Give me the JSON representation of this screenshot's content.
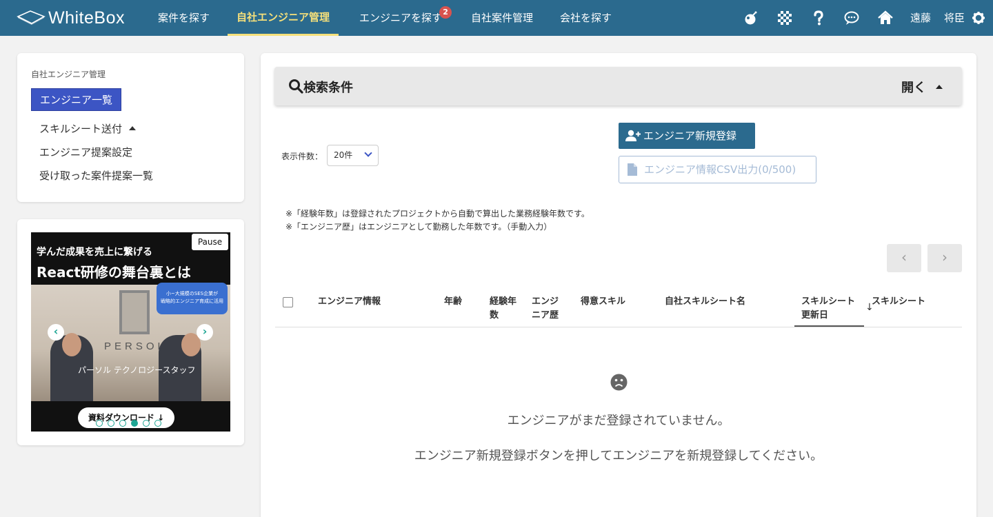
{
  "app": {
    "logo_text": "WhiteBox"
  },
  "nav": {
    "items": [
      {
        "label": "案件を探す"
      },
      {
        "label": "自社エンジニア管理"
      },
      {
        "label": "エンジニアを探す"
      },
      {
        "label": "自社案件管理"
      },
      {
        "label": "会社を探す"
      }
    ],
    "active_index": 1,
    "badge_count": "2"
  },
  "user": {
    "last_name": "遠藤",
    "first_name": "将臣"
  },
  "toolbar_icons": [
    "bomb-icon",
    "checkered-flag-icon",
    "question-icon",
    "chat-icon",
    "home-icon",
    "gear-icon"
  ],
  "sidebar": {
    "title": "自社エンジニア管理",
    "active_item": "エンジニア一覧",
    "items": [
      {
        "label": "スキルシート送付"
      },
      {
        "label": "エンジニア提案設定"
      },
      {
        "label": "受け取った案件提案一覧"
      }
    ]
  },
  "ad": {
    "line1": "学んだ成果を売上に繋げる",
    "line2": "React研修の舞台裏とは",
    "pause_label": "Pause",
    "bubble_line1": "小~大規模のSES企業が",
    "bubble_line2": "戦略的エンジニア育成に活用",
    "brand": "PERSOL",
    "tech_text": "パーソル テクノロジースタッフ",
    "download_label": "資料ダウンロード",
    "dots_total": 6,
    "active_dot": 3
  },
  "search": {
    "title": "検索条件",
    "toggle_label": "開く"
  },
  "controls": {
    "count_label": "表示件数：",
    "count_value": "20件",
    "new_button": "エンジニア新規登録",
    "csv_button": "エンジニア情報CSV出力(0/500)"
  },
  "notes": [
    "※「経験年数」は登録されたプロジェクトから自動で算出した業務経験年数です。",
    "※「エンジニア歴」はエンジニアとして勤務した年数です。（手動入力）"
  ],
  "pager": {
    "prev": "‹",
    "next": "›"
  },
  "table": {
    "headers": [
      {
        "line1": "エンジニア情報",
        "line2": ""
      },
      {
        "line1": "年齢",
        "line2": ""
      },
      {
        "line1": "経験年",
        "line2": "数"
      },
      {
        "line1": "エンジ",
        "line2": "ニア歴"
      },
      {
        "line1": "得意スキル",
        "line2": ""
      },
      {
        "line1": "自社スキルシート名",
        "line2": ""
      },
      {
        "line1": "スキルシート",
        "line2": "更新日"
      },
      {
        "line1": "スキルシート",
        "line2": ""
      }
    ],
    "sort_arrow": "↓"
  },
  "empty": {
    "message1": "エンジニアがまだ登録されていません。",
    "message2": "エンジニア新規登録ボタンを押してエンジニアを新規登録してください。"
  },
  "colors": {
    "header_bg": "#2b6a8e",
    "active_nav": "#f6e07a",
    "side_active": "#3c55c4",
    "badge": "#d9534f",
    "accent_teal": "#1ea694"
  }
}
